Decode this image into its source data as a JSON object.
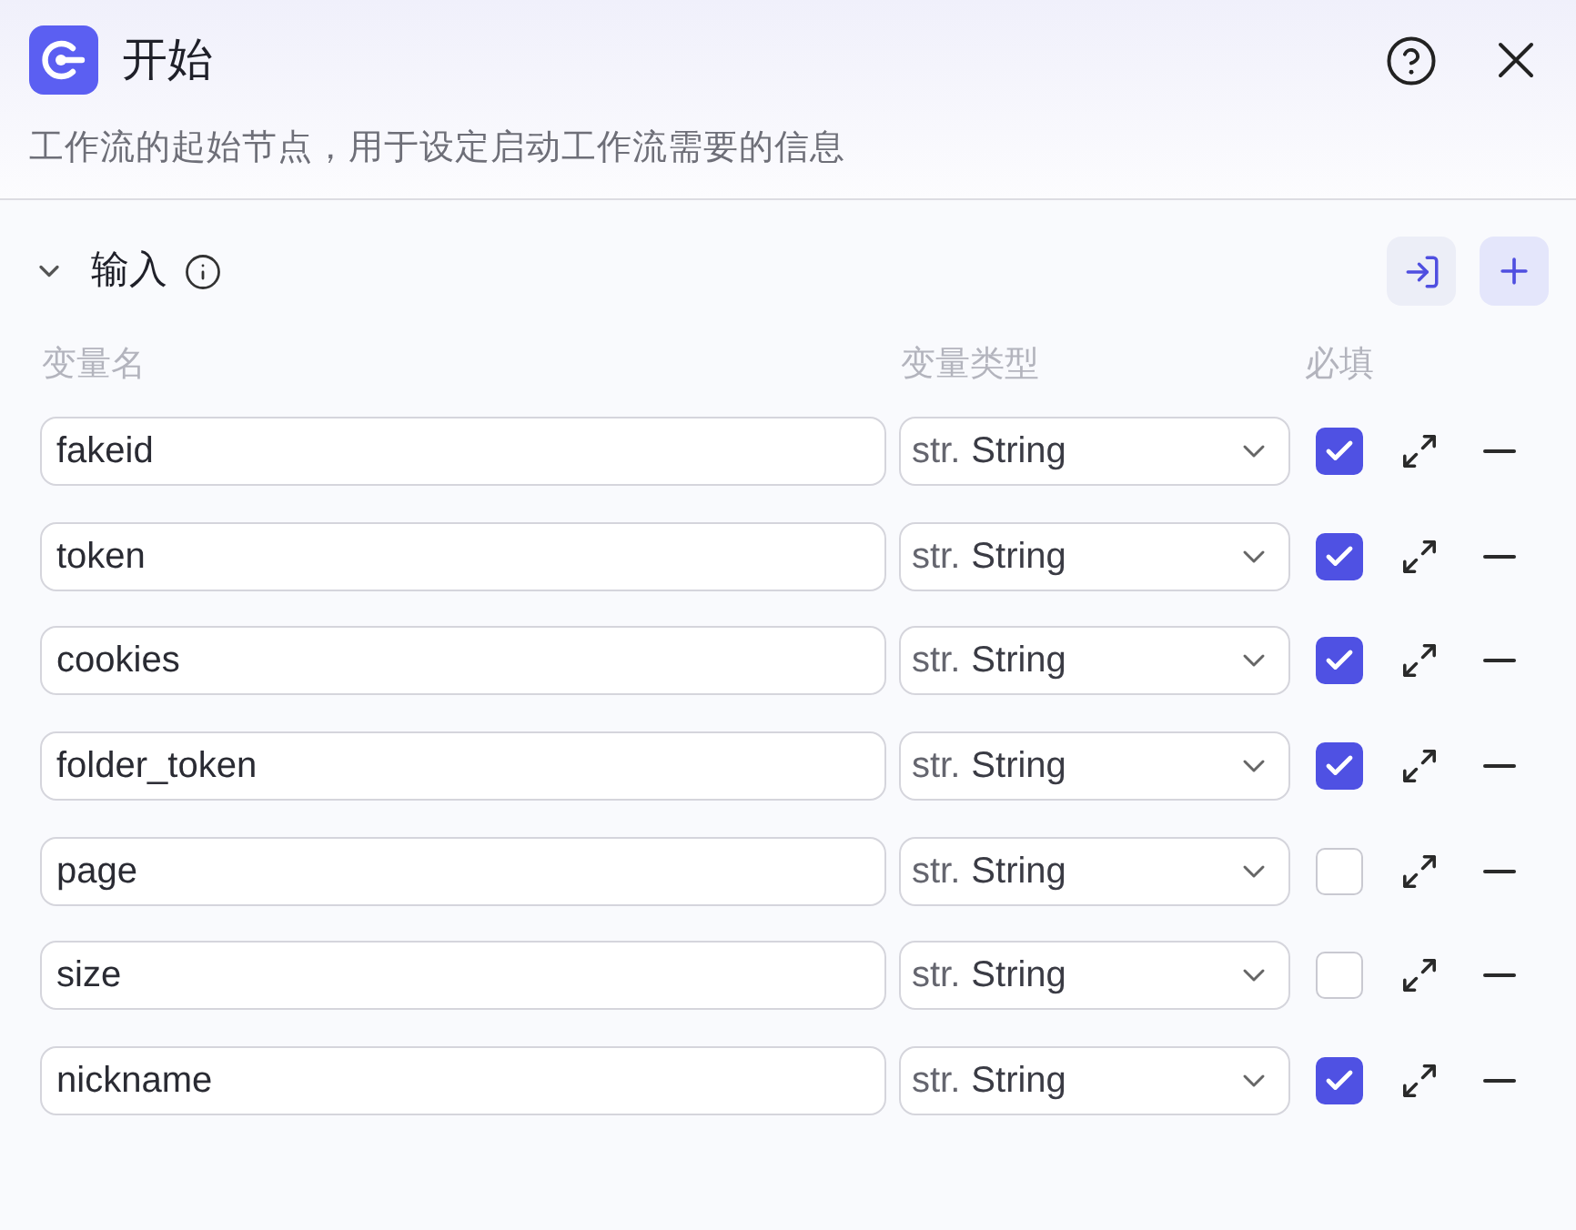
{
  "header": {
    "title": "开始",
    "description": "工作流的起始节点，用于设定启动工作流需要的信息"
  },
  "section": {
    "title": "输入",
    "expanded": true
  },
  "columns": [
    "变量名",
    "变量类型",
    "必填"
  ],
  "variables": [
    {
      "name": "fakeid",
      "type_prefix": "str.",
      "type": "String",
      "required": true
    },
    {
      "name": "token",
      "type_prefix": "str.",
      "type": "String",
      "required": true
    },
    {
      "name": "cookies",
      "type_prefix": "str.",
      "type": "String",
      "required": true
    },
    {
      "name": "folder_token",
      "type_prefix": "str.",
      "type": "String",
      "required": true
    },
    {
      "name": "page",
      "type_prefix": "str.",
      "type": "String",
      "required": false
    },
    {
      "name": "size",
      "type_prefix": "str.",
      "type": "String",
      "required": false
    },
    {
      "name": "nickname",
      "type_prefix": "str.",
      "type": "String",
      "required": true
    }
  ]
}
